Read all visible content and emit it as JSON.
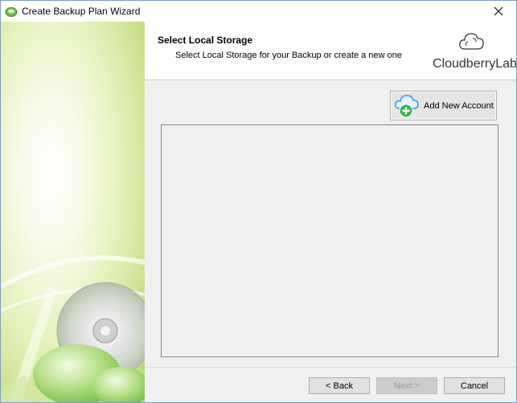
{
  "window": {
    "title": "Create Backup Plan Wizard",
    "icon": "cloudberry-backup-icon",
    "close_glyph": "✕"
  },
  "header": {
    "title": "Select Local Storage",
    "subtitle": "Select Local Storage for your Backup or create a new one",
    "logo_text": "CloudberryLab"
  },
  "main": {
    "add_account_label": "Add New Account",
    "storage_items": []
  },
  "footer": {
    "back_label": "< Back",
    "next_label": "Next >",
    "cancel_label": "Cancel",
    "next_enabled": false
  },
  "colors": {
    "sidebar_green": "#c8e08a",
    "add_icon_green": "#2db84d",
    "cloud_blue": "#3b9be0"
  }
}
